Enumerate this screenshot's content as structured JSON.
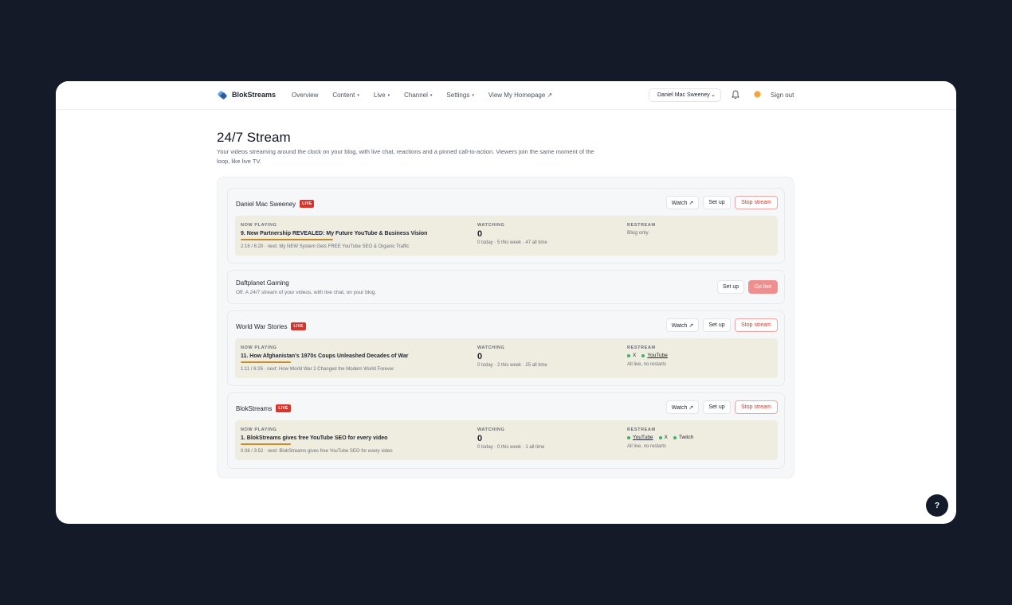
{
  "nav": {
    "brand": "BlokStreams",
    "items": [
      {
        "label": "Overview",
        "caret": ""
      },
      {
        "label": "Content",
        "caret": "▾"
      },
      {
        "label": "Live",
        "caret": "▾"
      },
      {
        "label": "Channel",
        "caret": "▾"
      },
      {
        "label": "Settings",
        "caret": "▾"
      },
      {
        "label": "View My Homepage ↗",
        "caret": ""
      }
    ],
    "account_selected": "Daniel Mac Sweeney",
    "sign_out": "Sign out"
  },
  "header": {
    "title": "24/7 Stream",
    "subtitle": "Your videos streaming around the clock on your blog, with live chat, reactions and a pinned call-to-action. Viewers join the same moment of the loop, like live TV."
  },
  "labels": {
    "now_playing": "NOW PLAYING",
    "watching": "WATCHING",
    "restream": "RESTREAM",
    "live": "LIVE",
    "watch": "Watch ↗",
    "set_up": "Set up",
    "stop_stream": "Stop stream",
    "go_live": "Go live"
  },
  "channels": [
    {
      "name": "Daniel Mac Sweeney",
      "live": true,
      "now_playing": "9. New Partnership REVEALED: My Future YouTube & Business Vision",
      "progress": 0.33,
      "playback": "2:16 / 6:20 · next: My NEW System Gets FREE YouTube SEO & Organic Traffic",
      "watching": "0",
      "watching_meta": "0 today · 5 this week · 47 all time",
      "restream_text": "Blog only"
    },
    {
      "name": "Daftplanet Gaming",
      "live": false,
      "description": "Off. A 24/7 stream of your videos, with live chat, on your blog."
    },
    {
      "name": "World War Stories",
      "live": true,
      "now_playing": "11. How Afghanistan's 1970s Coups Unleashed Decades of War",
      "progress": 0.18,
      "playback": "1:11 / 6:26 · next: How World War 2 Changed the Modern World Forever",
      "watching": "0",
      "watching_meta": "0 today · 2 this week · 25 all time",
      "restream_targets": [
        "X",
        "YouTube"
      ],
      "restream_meta": "All live, no restarts"
    },
    {
      "name": "BlokStreams",
      "live": true,
      "now_playing": "1. BlokStreams gives free YouTube SEO for every video",
      "progress": 0.18,
      "playback": "0:38 / 3:52 · next: BlokStreams gives free YouTube SEO for every video",
      "watching": "0",
      "watching_meta": "0 today · 0 this week · 1 all time",
      "restream_targets": [
        "YouTube",
        "X",
        "Twitch"
      ],
      "restream_meta": "All live, no restarts"
    }
  ],
  "help_label": "?",
  "colors": {
    "live_badge": "#d9342b",
    "progress": "#c98a2a",
    "status_dot": "#38b36a",
    "now_playing_bg": "#efece0"
  }
}
